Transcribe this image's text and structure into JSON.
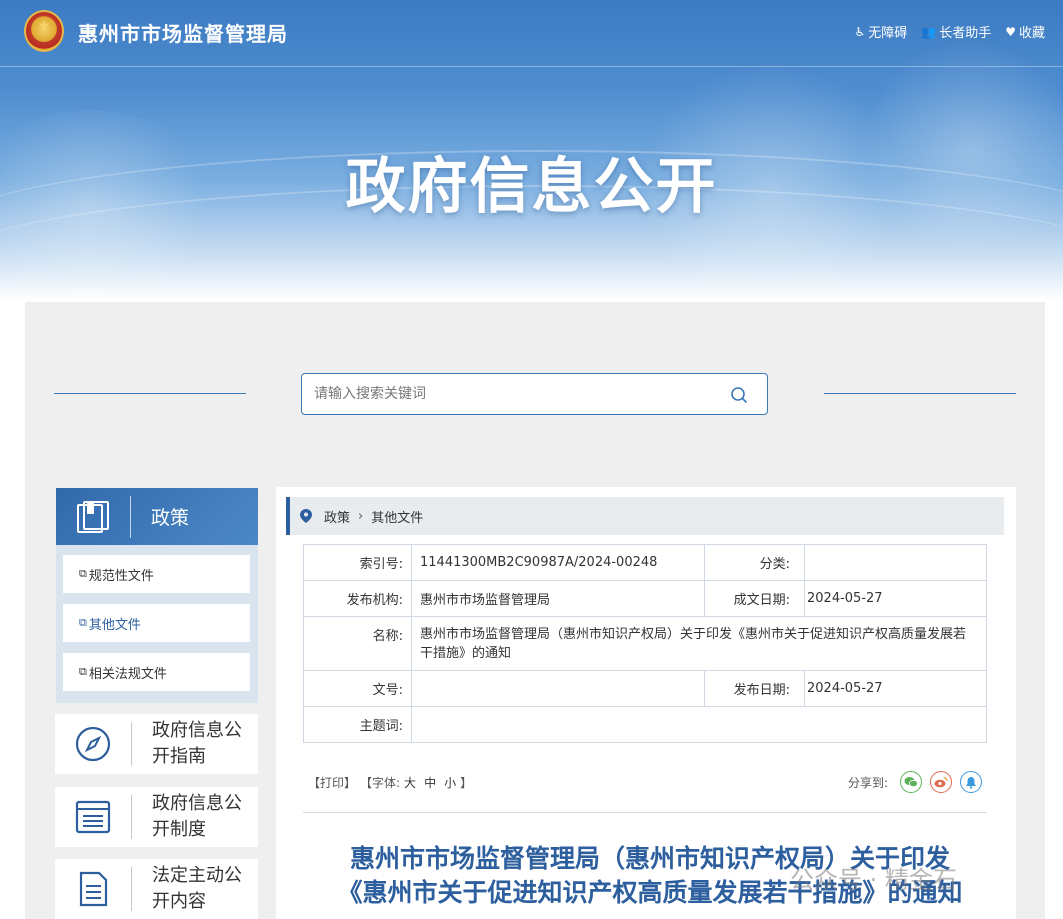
{
  "header": {
    "site_title": "惠州市市场监督管理局",
    "links": [
      {
        "label": "无障碍",
        "icon": "accessibility-icon"
      },
      {
        "label": "长者助手",
        "icon": "elder-icon"
      },
      {
        "label": "收藏",
        "icon": "heart-icon"
      }
    ],
    "banner_heading": "政府信息公开"
  },
  "search": {
    "placeholder": "请输入搜索关键词"
  },
  "sidebar": {
    "head_label": "政策",
    "items": [
      {
        "label": "规范性文件",
        "active": false
      },
      {
        "label": "其他文件",
        "active": true
      },
      {
        "label": "相关法规文件",
        "active": false
      }
    ],
    "cards": [
      {
        "label": "政府信息公开指南",
        "icon": "compass-icon"
      },
      {
        "label": "政府信息公开制度",
        "icon": "list-icon"
      },
      {
        "label": "法定主动公开内容",
        "icon": "document-icon"
      }
    ]
  },
  "breadcrumb": {
    "items": [
      "政策",
      "其他文件"
    ]
  },
  "meta": {
    "index_label": "索引号:",
    "index_value": "11441300MB2C90987A/2024-00248",
    "category_label": "分类:",
    "category_value": "",
    "publisher_label": "发布机构:",
    "publisher_value": "惠州市市场监督管理局",
    "created_label": "成文日期:",
    "created_value": "2024-05-27",
    "name_label": "名称:",
    "name_value": "惠州市市场监督管理局（惠州市知识产权局）关于印发《惠州市关于促进知识产权高质量发展若干措施》的通知",
    "docno_label": "文号:",
    "docno_value": "",
    "published_label": "发布日期:",
    "published_value": "2024-05-27",
    "subject_label": "主题词:",
    "subject_value": ""
  },
  "toolbar": {
    "print": "【打印】",
    "font_prefix": "【字体:",
    "font_large": "大",
    "font_medium": "中",
    "font_small": "小",
    "font_suffix": "】",
    "share_label": "分享到:"
  },
  "article": {
    "title_line1": "惠州市市场监督管理局（惠州市知识产权局）关于印发",
    "title_line2": "《惠州市关于促进知识产权高质量发展若干措施》的通知"
  },
  "watermark": "公众号 · 精金石",
  "colors": {
    "brand_blue": "#2d5f9f",
    "panel_grey": "#efefef",
    "sidebar_sub": "#d9e4ee"
  }
}
